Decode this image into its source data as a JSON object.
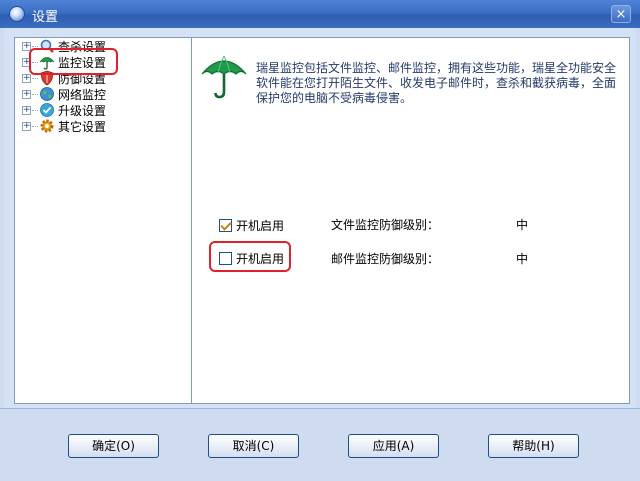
{
  "window": {
    "title": "设置",
    "close_glyph": "×"
  },
  "tree": {
    "items": [
      {
        "label": "查杀设置",
        "icon": "search-scan-icon"
      },
      {
        "label": "监控设置",
        "icon": "umbrella-icon",
        "selected": true
      },
      {
        "label": "防御设置",
        "icon": "shield-icon"
      },
      {
        "label": "网络监控",
        "icon": "globe-icon"
      },
      {
        "label": "升级设置",
        "icon": "update-check-icon"
      },
      {
        "label": "其它设置",
        "icon": "gear-icon"
      }
    ],
    "expander_glyph": "+"
  },
  "panel": {
    "description": "瑞星监控包括文件监控、邮件监控，拥有这些功能，瑞星全功能安全软件能在您打开陌生文件、收发电子邮件时，查杀和截获病毒，全面保护您的电脑不受病毒侵害。",
    "rows": [
      {
        "checkbox_label": "开机启用",
        "checked": true,
        "setting_label": "文件监控防御级别：",
        "level": "中"
      },
      {
        "checkbox_label": "开机启用",
        "checked": false,
        "setting_label": "邮件监控防御级别：",
        "level": "中"
      }
    ]
  },
  "buttons": {
    "ok": "确定(O)",
    "cancel": "取消(C)",
    "apply": "应用(A)",
    "help": "帮助(H)"
  },
  "colors": {
    "titlebar": "#3b6fc4",
    "highlight": "#e0202a",
    "text_blue": "#233a6b"
  }
}
